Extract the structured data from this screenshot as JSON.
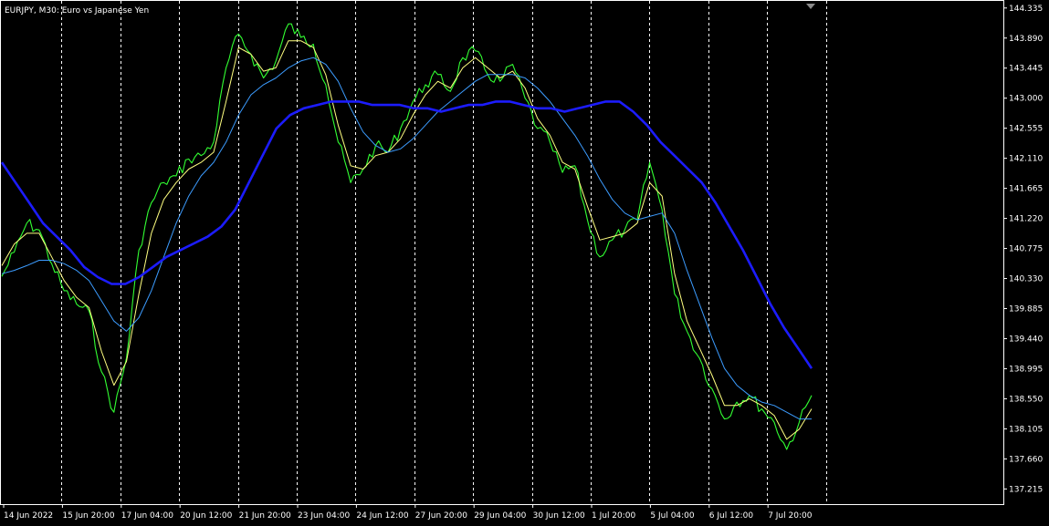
{
  "chart_title": "EURJPY, M30:  Euro vs Japanese Yen",
  "colors": {
    "background": "#000000",
    "axis": "#ffffff",
    "grid": "#ffffff",
    "price": "#32ff32",
    "ma_fast": "#ffff80",
    "ma_mid": "#3c9cff",
    "ma_slow": "#1c1cff"
  },
  "chart_data": {
    "type": "line",
    "title": "EURJPY, M30:  Euro vs Japanese Yen",
    "ylim": [
      136.99,
      144.44
    ],
    "y_ticks": [
      "144.335",
      "143.890",
      "143.445",
      "143.000",
      "142.555",
      "142.110",
      "141.665",
      "141.220",
      "140.775",
      "140.330",
      "139.885",
      "139.440",
      "138.995",
      "138.550",
      "138.105",
      "137.660",
      "137.215"
    ],
    "x_ticks": [
      "14 Jun 2022",
      "15 Jun 20:00",
      "17 Jun 04:00",
      "20 Jun 12:00",
      "21 Jun 20:00",
      "23 Jun 04:00",
      "24 Jun 12:00",
      "27 Jun 20:00",
      "29 Jun 04:00",
      "30 Jun 12:00",
      "1 Jul 20:00",
      "5 Jul 04:00",
      "6 Jul 12:00",
      "7 Jul 20:00"
    ],
    "grid": "vertical dashed",
    "series": [
      {
        "values": [
          140.36,
          140.72,
          141.15,
          141.05,
          140.55,
          140.15,
          139.95,
          139.85,
          138.95,
          138.35,
          139.15,
          140.75,
          141.45,
          141.75,
          141.85,
          142.1,
          142.15,
          142.35,
          143.45,
          143.95,
          143.65,
          143.3,
          143.55,
          144.1,
          143.9,
          143.8,
          143.2,
          142.35,
          141.75,
          141.95,
          142.3,
          142.2,
          142.55,
          142.95,
          143.2,
          143.35,
          143.1,
          143.6,
          143.7,
          143.35,
          143.25,
          143.5,
          143.0,
          142.55,
          142.35,
          141.9,
          142.0,
          141.2,
          140.65,
          140.9,
          141.05,
          141.2,
          142.05,
          141.35,
          140.1,
          139.55,
          139.15,
          138.7,
          138.25,
          138.5,
          138.6,
          138.4,
          138.2,
          137.8,
          138.2,
          138.6
        ]
      },
      {
        "values": [
          140.52,
          140.84,
          141.0,
          141.0,
          140.65,
          140.3,
          140.05,
          139.9,
          139.25,
          138.75,
          139.1,
          140.1,
          141.0,
          141.5,
          141.75,
          141.95,
          142.05,
          142.2,
          142.95,
          143.75,
          143.65,
          143.4,
          143.45,
          143.85,
          143.85,
          143.75,
          143.35,
          142.6,
          142.0,
          141.95,
          142.15,
          142.2,
          142.4,
          142.75,
          143.05,
          143.25,
          143.15,
          143.45,
          143.6,
          143.45,
          143.3,
          143.4,
          143.15,
          142.7,
          142.45,
          142.05,
          141.95,
          141.4,
          140.9,
          140.95,
          141.0,
          141.15,
          141.75,
          141.55,
          140.4,
          139.7,
          139.3,
          138.9,
          138.45,
          138.45,
          138.55,
          138.45,
          138.3,
          137.95,
          138.1,
          138.4
        ]
      },
      {
        "values": [
          140.4,
          140.45,
          140.52,
          140.6,
          140.6,
          140.55,
          140.45,
          140.3,
          140.0,
          139.7,
          139.55,
          139.75,
          140.15,
          140.65,
          141.15,
          141.55,
          141.85,
          142.05,
          142.35,
          142.75,
          143.05,
          143.2,
          143.3,
          143.45,
          143.55,
          143.6,
          143.5,
          143.25,
          142.85,
          142.5,
          142.3,
          142.2,
          142.25,
          142.4,
          142.6,
          142.8,
          142.95,
          143.1,
          143.25,
          143.35,
          143.35,
          143.35,
          143.3,
          143.15,
          142.95,
          142.7,
          142.45,
          142.15,
          141.8,
          141.5,
          141.3,
          141.2,
          141.25,
          141.3,
          141.0,
          140.45,
          139.95,
          139.45,
          139.0,
          138.75,
          138.6,
          138.5,
          138.45,
          138.35,
          138.25,
          138.25
        ]
      },
      {
        "values": [
          142.05,
          141.75,
          141.45,
          141.15,
          140.95,
          140.75,
          140.5,
          140.35,
          140.25,
          140.25,
          140.35,
          140.5,
          140.65,
          140.75,
          140.85,
          140.95,
          141.1,
          141.35,
          141.75,
          142.15,
          142.55,
          142.75,
          142.85,
          142.9,
          142.95,
          142.95,
          142.95,
          142.9,
          142.9,
          142.9,
          142.85,
          142.85,
          142.8,
          142.85,
          142.9,
          142.9,
          142.95,
          142.95,
          142.9,
          142.85,
          142.85,
          142.8,
          142.85,
          142.9,
          142.95,
          142.95,
          142.8,
          142.6,
          142.35,
          142.15,
          141.95,
          141.75,
          141.45,
          141.1,
          140.75,
          140.35,
          139.95,
          139.6,
          139.3,
          139.0
        ]
      }
    ]
  }
}
